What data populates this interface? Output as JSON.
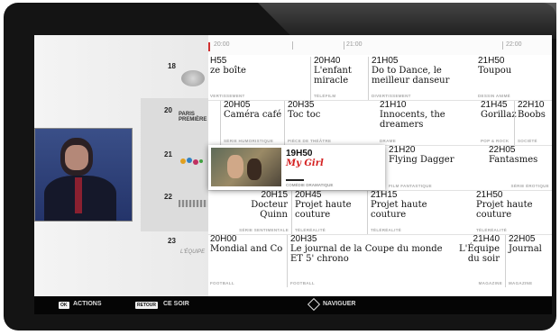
{
  "timeline": {
    "t1": "20:00",
    "t2": "21:00",
    "t3": "22:00"
  },
  "channels": [
    {
      "number": "18"
    },
    {
      "number": "20",
      "logo": "PARIS PREMIÈRE"
    },
    {
      "number": "21"
    },
    {
      "number": "22"
    },
    {
      "number": "23",
      "logo": "L'ÉQUIPE"
    }
  ],
  "rows": [
    [
      {
        "time": "H55",
        "title": "ze boîte",
        "genre": "VERTISSEMENT"
      },
      {
        "time": "20H40",
        "title": "L'enfant miracle",
        "genre": "TÉLÉFILM"
      },
      {
        "time": "21H05",
        "title": "Do to Dance, le meilleur danseur",
        "genre": "DIVERTISSEMENT"
      },
      {
        "time": "21H50",
        "title": "Toupou",
        "genre": "DESSIN ANIMÉ"
      }
    ],
    [
      {
        "time": "20H05",
        "title": "Caméra café",
        "genre": "SÉRIE HUMORISTIQUE"
      },
      {
        "time": "20H35",
        "title": "Toc toc",
        "genre": "PIÈCE DE THÉÂTRE"
      },
      {
        "time": "21H10",
        "title": "Innocents, the dreamers",
        "genre": "DRAME"
      },
      {
        "time": "21H45",
        "title": "Gorillaz",
        "genre": "POP & ROCK"
      },
      {
        "time": "22H10",
        "title": "Boobs",
        "genre": "SOCIÉTÉ"
      }
    ],
    [
      {
        "time": "21H20",
        "title": "Flying Dagger",
        "genre": "FILM FANTASTIQUE"
      },
      {
        "time": "22H05",
        "title": "Fantasmes",
        "genre": "SÉRIE ÉROTIQUE"
      }
    ],
    [
      {
        "time": "20H15",
        "title": "Docteur Quinn",
        "genre": "SÉRIE SENTIMENTALE"
      },
      {
        "time": "20H45",
        "title": "Projet haute couture",
        "genre": "TÉLÉRÉALITÉ"
      },
      {
        "time": "21H15",
        "title": "Projet haute couture",
        "genre": "TÉLÉRÉALITÉ"
      },
      {
        "time": "21H50",
        "title": "Projet haute couture",
        "genre": "TÉLÉRÉALITÉ"
      }
    ],
    [
      {
        "time": "20H00",
        "title": "Mondial and Co",
        "genre": "FOOTBALL"
      },
      {
        "time": "20H35",
        "title": "Le journal de la Coupe du monde ET 5' chrono",
        "genre": "FOOTBALL"
      },
      {
        "time": "21H40",
        "title": "L'Équipe du soir",
        "genre": "MAGAZINE"
      },
      {
        "time": "22H05",
        "title": "Journal",
        "genre": "MAGAZINE"
      }
    ]
  ],
  "selected": {
    "time": "19H50",
    "title": "My Girl",
    "genre": "COMÉDIE DRAMATIQUE"
  },
  "bottom": {
    "ok_key": "OK",
    "actions": "ACTIONS",
    "retour_key": "RETOUR",
    "ce_soir": "CE SOIR",
    "naviguer": "NAVIGUER"
  },
  "colors": {
    "accent": "#d42020",
    "frame": "#141414",
    "bar": "#050505"
  }
}
